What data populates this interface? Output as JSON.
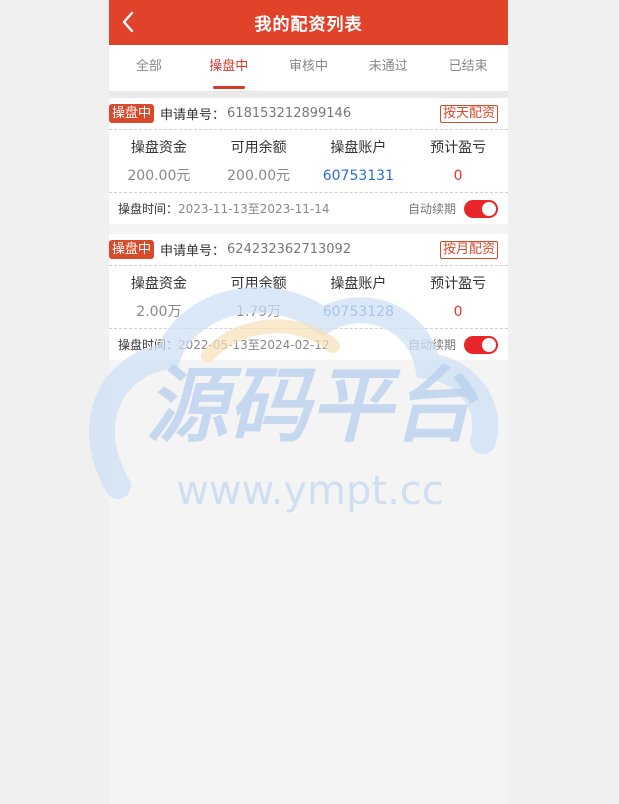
{
  "header": {
    "title": "我的配资列表",
    "back_icon": "chevron-left-icon"
  },
  "tabs": [
    {
      "label": "全部",
      "active": false
    },
    {
      "label": "操盘中",
      "active": true
    },
    {
      "label": "审核中",
      "active": false
    },
    {
      "label": "未通过",
      "active": false
    },
    {
      "label": "已结束",
      "active": false
    }
  ],
  "cards": [
    {
      "status": "操盘中",
      "order_label": "申请单号：",
      "order_no": "618153212899146",
      "type": "按天配资",
      "cols": [
        {
          "header": "操盘资金",
          "value": "200.00元"
        },
        {
          "header": "可用余额",
          "value": "200.00元"
        },
        {
          "header": "操盘账户",
          "value": "60753131"
        },
        {
          "header": "预计盈亏",
          "value": "0"
        }
      ],
      "time_label": "操盘时间：",
      "time_range": "2023-11-13至2023-11-14",
      "auto_label": "自动续期",
      "auto_on": true
    },
    {
      "status": "操盘中",
      "order_label": "申请单号：",
      "order_no": "624232362713092",
      "type": "按月配资",
      "cols": [
        {
          "header": "操盘资金",
          "value": "2.00万"
        },
        {
          "header": "可用余额",
          "value": "1.79万"
        },
        {
          "header": "操盘账户",
          "value": "60753128"
        },
        {
          "header": "预计盈亏",
          "value": "0"
        }
      ],
      "time_label": "操盘时间：",
      "time_range": "2022-05-13至2024-02-12",
      "auto_label": "自动续期",
      "auto_on": true
    }
  ],
  "watermark": {
    "title": "源码平台",
    "url": "www.ympt.cc"
  },
  "colors": {
    "accent": "#e1432a",
    "link": "#2a6ed4",
    "loss": "#e5352a",
    "toggle_on": "#e8262a"
  }
}
